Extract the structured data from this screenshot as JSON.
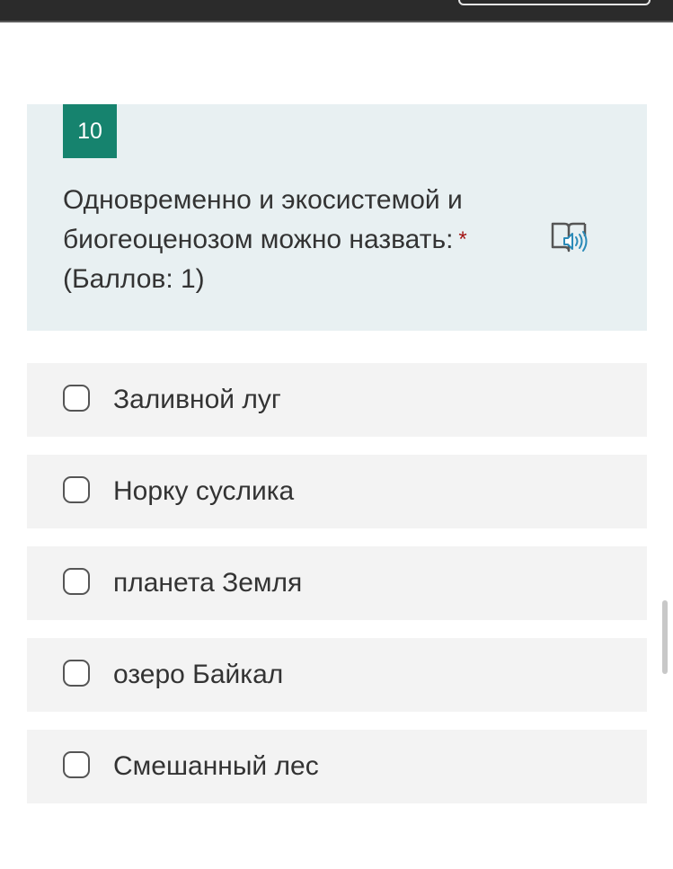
{
  "question": {
    "number": "10",
    "text_line1": "Одновременно и экосистемой и",
    "text_line2": "биогеоценозом можно назвать:",
    "required_mark": "*",
    "points": "(Баллов: 1)",
    "accent_color": "#16836e",
    "required_color": "#a31515"
  },
  "icons": {
    "reader": "immersive-reader-icon"
  },
  "options": [
    {
      "label": "Заливной луг",
      "checked": false
    },
    {
      "label": "Норку суслика",
      "checked": false
    },
    {
      "label": "планета Земля",
      "checked": false
    },
    {
      "label": "озеро Байкал",
      "checked": false
    },
    {
      "label": "Смешанный лес",
      "checked": false
    }
  ]
}
